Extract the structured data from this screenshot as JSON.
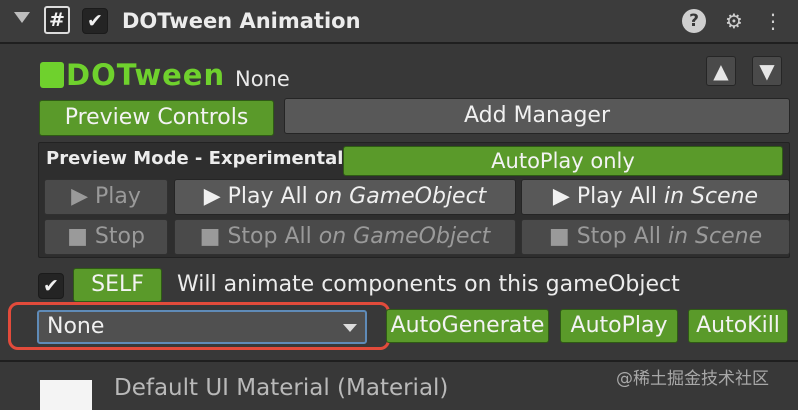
{
  "header": {
    "component_icon": "#",
    "enabled_check": "✔",
    "title": "DOTween Animation",
    "help_icon": "?",
    "settings_icon": "⚙",
    "more_icon": "⋮"
  },
  "logo": {
    "text": "DOTween"
  },
  "target": {
    "label": "None"
  },
  "order_buttons": {
    "up": "▲",
    "down": "▼"
  },
  "tool_buttons": {
    "preview_controls": "Preview Controls",
    "add_manager": "Add Manager"
  },
  "preview": {
    "mode_label": "Preview Mode - Experimental",
    "mode_value": "AutoPlay only",
    "play": {
      "icon": "▶",
      "label": "Play"
    },
    "play_all_object": {
      "icon": "▶",
      "label": "Play All",
      "suffix": "on GameObject"
    },
    "play_all_scene": {
      "icon": "▶",
      "label": "Play All",
      "suffix": "in Scene"
    },
    "stop": {
      "icon": "■",
      "label": "Stop"
    },
    "stop_all_object": {
      "icon": "■",
      "label": "Stop All",
      "suffix": "on GameObject"
    },
    "stop_all_scene": {
      "icon": "■",
      "label": "Stop All",
      "suffix": "in Scene"
    }
  },
  "self_row": {
    "check": "✔",
    "self_button": "SELF",
    "description": "Will animate components on this gameObject"
  },
  "options": {
    "dropdown_value": "None",
    "auto_generate": "AutoGenerate",
    "auto_play": "AutoPlay",
    "auto_kill": "AutoKill"
  },
  "material": {
    "label": "Default UI Material (Material)"
  },
  "watermark": "@稀土掘金技术社区",
  "colors": {
    "accent_green": "#5a9a2a",
    "logo_green": "#6fd12d",
    "highlight_red": "#e24b3b",
    "focus_blue": "#5f8bb8"
  }
}
